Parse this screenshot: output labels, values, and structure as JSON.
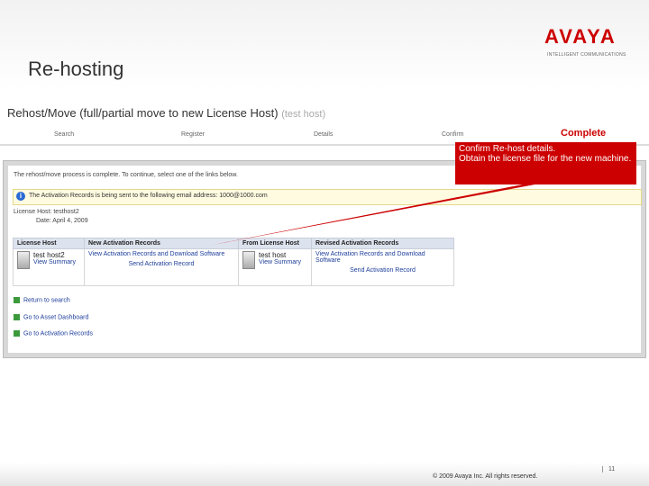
{
  "brand": {
    "logo": "AVAYA",
    "tagline": "INTELLIGENT COMMUNICATIONS",
    "accent": "#cc0000"
  },
  "slide_title": "Re-hosting",
  "page": {
    "heading": "Rehost/Move (full/partial move to new License Host)",
    "heading_suffix": "(test host)",
    "steps": [
      "Search",
      "Register",
      "Details",
      "Confirm",
      "Complete"
    ],
    "active_step": "Complete"
  },
  "panel": {
    "message": "The rehost/move process is complete. To continue, select one of the links below.",
    "notice": "The Activation Records is being sent to the following email address: 1000@1000.com",
    "license_host_label": "License Host: testhost2",
    "date_label": "Date: April 4, 2009",
    "table": {
      "headers": [
        "License Host",
        "New Activation Records",
        "From License Host",
        "Revised Activation Records"
      ],
      "row": {
        "host1_name": "test host2",
        "host1_summary": "View Summary",
        "new_records_link": "View Activation Records and Download Software",
        "send1": "Send Activation Record",
        "host2_name": "test host",
        "host2_summary": "View Summary",
        "revised_records_link": "View Activation Records and Download Software",
        "send2": "Send Activation Record"
      }
    },
    "links": [
      "Return to search",
      "Go to Asset Dashboard",
      "Go to Activation Records"
    ]
  },
  "callout": {
    "lines": [
      "Confirm Re-host details.",
      "Obtain the license file for the new machine."
    ]
  },
  "footer": {
    "copyright": "© 2009 Avaya Inc. All rights reserved.",
    "page_number": "11"
  }
}
